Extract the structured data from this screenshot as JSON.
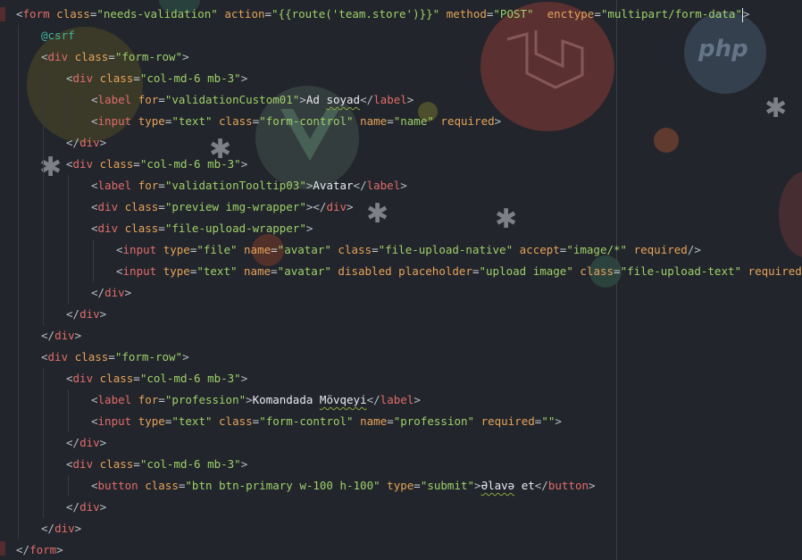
{
  "editor": {
    "lines": [
      {
        "indent": 0,
        "tokens": [
          [
            "tag-open",
            "<"
          ],
          [
            "tag",
            "form"
          ],
          [
            "sp",
            " "
          ],
          [
            "attr",
            "class"
          ],
          [
            "eq",
            "="
          ],
          [
            "str",
            "\"needs-validation\""
          ],
          [
            "sp",
            " "
          ],
          [
            "attr",
            "action"
          ],
          [
            "eq",
            "="
          ],
          [
            "str",
            "\"{{route('team.store')}}\""
          ],
          [
            "sp",
            " "
          ],
          [
            "attr",
            "method"
          ],
          [
            "eq",
            "="
          ],
          [
            "str",
            "\"POST\""
          ],
          [
            "sp",
            "  "
          ],
          [
            "attr",
            "enctype"
          ],
          [
            "eq",
            "="
          ],
          [
            "str",
            "\"multipart/form-data\""
          ],
          [
            "br",
            ">"
          ]
        ]
      },
      {
        "indent": 1,
        "tokens": [
          [
            "dir",
            "@csrf"
          ]
        ]
      },
      {
        "indent": 1,
        "tokens": [
          [
            "br",
            "<"
          ],
          [
            "tag",
            "div"
          ],
          [
            "sp",
            " "
          ],
          [
            "attr",
            "class"
          ],
          [
            "eq",
            "="
          ],
          [
            "str",
            "\"form-row\""
          ],
          [
            "br",
            ">"
          ]
        ]
      },
      {
        "indent": 2,
        "tokens": [
          [
            "br",
            "<"
          ],
          [
            "tag",
            "div"
          ],
          [
            "sp",
            " "
          ],
          [
            "attr",
            "class"
          ],
          [
            "eq",
            "="
          ],
          [
            "str",
            "\"col-md-6 mb-3\""
          ],
          [
            "br",
            ">"
          ]
        ]
      },
      {
        "indent": 3,
        "tokens": [
          [
            "br",
            "<"
          ],
          [
            "tag",
            "label"
          ],
          [
            "sp",
            " "
          ],
          [
            "attr",
            "for"
          ],
          [
            "eq",
            "="
          ],
          [
            "str",
            "\"validationCustom01\""
          ],
          [
            "br",
            ">"
          ],
          [
            "txt",
            "Ad "
          ],
          [
            "txtsq",
            "soyad"
          ],
          [
            "br",
            "</"
          ],
          [
            "tag",
            "label"
          ],
          [
            "br",
            ">"
          ]
        ]
      },
      {
        "indent": 3,
        "tokens": [
          [
            "br",
            "<"
          ],
          [
            "tag",
            "input"
          ],
          [
            "sp",
            " "
          ],
          [
            "attr",
            "type"
          ],
          [
            "eq",
            "="
          ],
          [
            "str",
            "\"text\""
          ],
          [
            "sp",
            " "
          ],
          [
            "attr",
            "class"
          ],
          [
            "eq",
            "="
          ],
          [
            "str",
            "\"form-control\""
          ],
          [
            "sp",
            " "
          ],
          [
            "attr",
            "name"
          ],
          [
            "eq",
            "="
          ],
          [
            "str",
            "\"name\""
          ],
          [
            "sp",
            " "
          ],
          [
            "attr",
            "required"
          ],
          [
            "br",
            ">"
          ]
        ]
      },
      {
        "indent": 2,
        "tokens": [
          [
            "br",
            "</"
          ],
          [
            "tag",
            "div"
          ],
          [
            "br",
            ">"
          ]
        ]
      },
      {
        "indent": 2,
        "tokens": [
          [
            "br",
            "<"
          ],
          [
            "tag",
            "div"
          ],
          [
            "sp",
            " "
          ],
          [
            "attr",
            "class"
          ],
          [
            "eq",
            "="
          ],
          [
            "str",
            "\"col-md-6 mb-3\""
          ],
          [
            "br",
            ">"
          ]
        ]
      },
      {
        "indent": 3,
        "tokens": [
          [
            "br",
            "<"
          ],
          [
            "tag",
            "label"
          ],
          [
            "sp",
            " "
          ],
          [
            "attr",
            "for"
          ],
          [
            "eq",
            "="
          ],
          [
            "str",
            "\"validationTooltip03\""
          ],
          [
            "br",
            ">"
          ],
          [
            "txt",
            "Avatar"
          ],
          [
            "br",
            "</"
          ],
          [
            "tag",
            "label"
          ],
          [
            "br",
            ">"
          ]
        ]
      },
      {
        "indent": 3,
        "tokens": [
          [
            "br",
            "<"
          ],
          [
            "tag",
            "div"
          ],
          [
            "sp",
            " "
          ],
          [
            "attr",
            "class"
          ],
          [
            "eq",
            "="
          ],
          [
            "str",
            "\"preview img-wrapper\""
          ],
          [
            "br",
            "></"
          ],
          [
            "tag",
            "div"
          ],
          [
            "br",
            ">"
          ]
        ]
      },
      {
        "indent": 3,
        "tokens": [
          [
            "br",
            "<"
          ],
          [
            "tag",
            "div"
          ],
          [
            "sp",
            " "
          ],
          [
            "attr",
            "class"
          ],
          [
            "eq",
            "="
          ],
          [
            "str",
            "\"file-upload-wrapper\""
          ],
          [
            "br",
            ">"
          ]
        ]
      },
      {
        "indent": 4,
        "tokens": [
          [
            "br",
            "<"
          ],
          [
            "tag",
            "input"
          ],
          [
            "sp",
            " "
          ],
          [
            "attr",
            "type"
          ],
          [
            "eq",
            "="
          ],
          [
            "str",
            "\"file\""
          ],
          [
            "sp",
            " "
          ],
          [
            "attr",
            "name"
          ],
          [
            "eq",
            "="
          ],
          [
            "str",
            "\"avatar\""
          ],
          [
            "sp",
            " "
          ],
          [
            "attr",
            "class"
          ],
          [
            "eq",
            "="
          ],
          [
            "str",
            "\"file-upload-native\""
          ],
          [
            "sp",
            " "
          ],
          [
            "attr",
            "accept"
          ],
          [
            "eq",
            "="
          ],
          [
            "str",
            "\"image/*\""
          ],
          [
            "sp",
            " "
          ],
          [
            "attr",
            "required"
          ],
          [
            "br",
            "/>"
          ]
        ]
      },
      {
        "indent": 4,
        "tokens": [
          [
            "br",
            "<"
          ],
          [
            "tag",
            "input"
          ],
          [
            "sp",
            " "
          ],
          [
            "attr",
            "type"
          ],
          [
            "eq",
            "="
          ],
          [
            "str",
            "\"text\""
          ],
          [
            "sp",
            " "
          ],
          [
            "attr",
            "name"
          ],
          [
            "eq",
            "="
          ],
          [
            "str",
            "\"avatar\""
          ],
          [
            "sp",
            " "
          ],
          [
            "attr",
            "disabled"
          ],
          [
            "sp",
            " "
          ],
          [
            "attr",
            "placeholder"
          ],
          [
            "eq",
            "="
          ],
          [
            "str",
            "\"upload image\""
          ],
          [
            "sp",
            " "
          ],
          [
            "attr",
            "class"
          ],
          [
            "eq",
            "="
          ],
          [
            "str",
            "\"file-upload-text\""
          ],
          [
            "sp",
            " "
          ],
          [
            "attr",
            "required"
          ],
          [
            "br",
            "/>"
          ]
        ]
      },
      {
        "indent": 3,
        "tokens": [
          [
            "br",
            "</"
          ],
          [
            "tag",
            "div"
          ],
          [
            "br",
            ">"
          ]
        ]
      },
      {
        "indent": 2,
        "tokens": [
          [
            "br",
            "</"
          ],
          [
            "tag",
            "div"
          ],
          [
            "br",
            ">"
          ]
        ]
      },
      {
        "indent": 1,
        "tokens": [
          [
            "br",
            "</"
          ],
          [
            "tag",
            "div"
          ],
          [
            "br",
            ">"
          ]
        ]
      },
      {
        "indent": 1,
        "tokens": [
          [
            "br",
            "<"
          ],
          [
            "tag",
            "div"
          ],
          [
            "sp",
            " "
          ],
          [
            "attr",
            "class"
          ],
          [
            "eq",
            "="
          ],
          [
            "str",
            "\"form-row\""
          ],
          [
            "br",
            ">"
          ]
        ]
      },
      {
        "indent": 2,
        "tokens": [
          [
            "br",
            "<"
          ],
          [
            "tag",
            "div"
          ],
          [
            "sp",
            " "
          ],
          [
            "attr",
            "class"
          ],
          [
            "eq",
            "="
          ],
          [
            "str",
            "\"col-md-6 mb-3\""
          ],
          [
            "br",
            ">"
          ]
        ]
      },
      {
        "indent": 3,
        "tokens": [
          [
            "br",
            "<"
          ],
          [
            "tag",
            "label"
          ],
          [
            "sp",
            " "
          ],
          [
            "attr",
            "for"
          ],
          [
            "eq",
            "="
          ],
          [
            "str",
            "\"profession\""
          ],
          [
            "br",
            ">"
          ],
          [
            "txt",
            "Komandada "
          ],
          [
            "txtsq",
            "Mövqeyi"
          ],
          [
            "br",
            "</"
          ],
          [
            "tag",
            "label"
          ],
          [
            "br",
            ">"
          ]
        ]
      },
      {
        "indent": 3,
        "tokens": [
          [
            "br",
            "<"
          ],
          [
            "tag",
            "input"
          ],
          [
            "sp",
            " "
          ],
          [
            "attr",
            "type"
          ],
          [
            "eq",
            "="
          ],
          [
            "str",
            "\"text\""
          ],
          [
            "sp",
            " "
          ],
          [
            "attr",
            "class"
          ],
          [
            "eq",
            "="
          ],
          [
            "str",
            "\"form-control\""
          ],
          [
            "sp",
            " "
          ],
          [
            "attr",
            "name"
          ],
          [
            "eq",
            "="
          ],
          [
            "str",
            "\"profession\""
          ],
          [
            "sp",
            " "
          ],
          [
            "attr",
            "required"
          ],
          [
            "eq",
            "="
          ],
          [
            "str",
            "\"\""
          ],
          [
            "br",
            ">"
          ]
        ]
      },
      {
        "indent": 2,
        "tokens": [
          [
            "br",
            "</"
          ],
          [
            "tag",
            "div"
          ],
          [
            "br",
            ">"
          ]
        ]
      },
      {
        "indent": 2,
        "tokens": [
          [
            "br",
            "<"
          ],
          [
            "tag",
            "div"
          ],
          [
            "sp",
            " "
          ],
          [
            "attr",
            "class"
          ],
          [
            "eq",
            "="
          ],
          [
            "str",
            "\"col-md-6 mb-3\""
          ],
          [
            "br",
            ">"
          ]
        ]
      },
      {
        "indent": 3,
        "tokens": [
          [
            "br",
            "<"
          ],
          [
            "tag",
            "button"
          ],
          [
            "sp",
            " "
          ],
          [
            "attr",
            "class"
          ],
          [
            "eq",
            "="
          ],
          [
            "str",
            "\"btn btn-primary w-100 h-100\""
          ],
          [
            "sp",
            " "
          ],
          [
            "attr",
            "type"
          ],
          [
            "eq",
            "="
          ],
          [
            "str",
            "\"submit\""
          ],
          [
            "br",
            ">"
          ],
          [
            "txtsq",
            "Əlavə"
          ],
          [
            "txt",
            " et"
          ],
          [
            "br",
            "</"
          ],
          [
            "tag",
            "button"
          ],
          [
            "br",
            ">"
          ]
        ]
      },
      {
        "indent": 2,
        "tokens": [
          [
            "br",
            "</"
          ],
          [
            "tag",
            "div"
          ],
          [
            "br",
            ">"
          ]
        ]
      },
      {
        "indent": 1,
        "tokens": [
          [
            "br",
            "</"
          ],
          [
            "tag",
            "div"
          ],
          [
            "br",
            ">"
          ]
        ]
      },
      {
        "indent": 0,
        "tokens": [
          [
            "br",
            "</"
          ],
          [
            "tag",
            "form"
          ],
          [
            "br",
            ">"
          ]
        ]
      }
    ]
  },
  "background": {
    "php_logo_text": "php"
  },
  "colors": {
    "background": "#22252b",
    "tag": "#e06c6c",
    "attribute": "#e5a35a",
    "string": "#9fcf6a",
    "directive": "#3fb6a0",
    "text": "#e8ebef"
  },
  "icons": [
    "laravel-logo-icon",
    "php-logo-icon",
    "vue-logo-icon",
    "asterisk-icon"
  ]
}
